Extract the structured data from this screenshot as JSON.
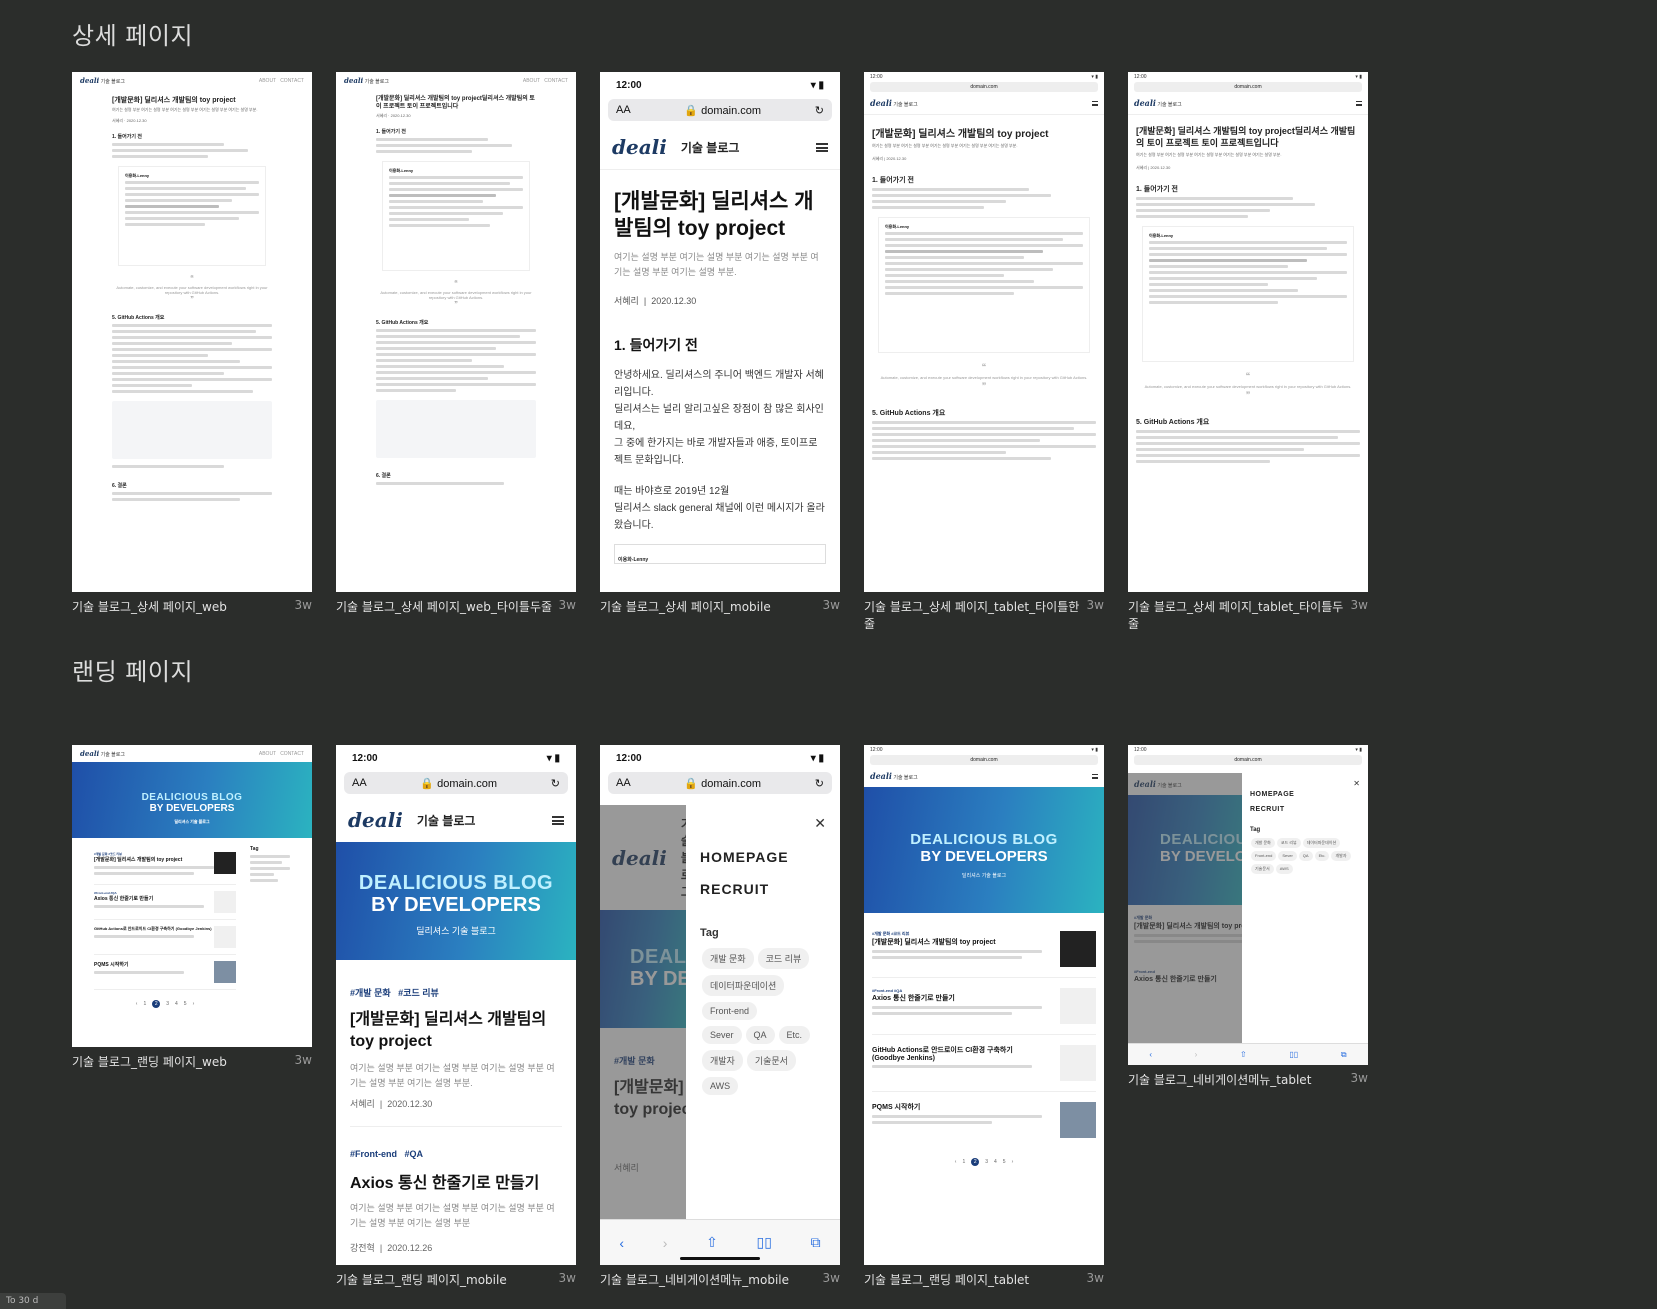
{
  "sections": {
    "detail": "상세 페이지",
    "landing": "랜딩 페이지"
  },
  "frames": [
    {
      "name": "기술 블로그_상세 페이지_web",
      "age": "3w"
    },
    {
      "name": "기술 블로그_상세 페이지_web_타이틀두줄",
      "age": "3w"
    },
    {
      "name": "기술 블로그_상세 페이지_mobile",
      "age": "3w"
    },
    {
      "name": "기술 블로그_상세 페이지_tablet_타이틀한줄",
      "age": "3w"
    },
    {
      "name": "기술 블로그_상세 페이지_tablet_타이틀두줄",
      "age": "3w"
    },
    {
      "name": "기술 블로그_랜딩 페이지_web",
      "age": "3w"
    },
    {
      "name": "기술 블로그_랜딩 페이지_mobile",
      "age": "3w"
    },
    {
      "name": "기술 블로그_네비게이션메뉴_mobile",
      "age": "3w"
    },
    {
      "name": "기술 블로그_랜딩 페이지_tablet",
      "age": "3w"
    },
    {
      "name": "기술 블로그_네비게이션메뉴_tablet",
      "age": "3w"
    }
  ],
  "content": {
    "blog_name": "기술 블로그",
    "logo_text": "deali",
    "status_time": "12:00",
    "url": "domain.com",
    "url_aa": "AA",
    "post_title_1line": "[개발문화] 딜리셔스 개발팀의 toy project",
    "post_title_2line": "[개발문화] 딜리셔스 개발팀의 toy project딜리셔스 개발팀의 토이 프로젝트 토이 프로젝트입니다",
    "mobile_title": "[개발문화] 딜리셔스 개발팀의 toy project",
    "post_desc": "여기는 설명 부분 여기는 설명 부분 여기는 설명 부분 여기는 설명 부분 여기는 설명 부분.",
    "author": "서혜리",
    "date": "2020.12.30",
    "section1": "1. 들어가기 전",
    "intro_1": "안녕하세요. 딜리셔스의 주니어 백엔드 개발자 서혜리입니다.",
    "intro_2": "딜리셔스는 널리 알리고싶은 장점이 참 많은 회사인데요,",
    "intro_3": "그 중에 한가지는 바로 개발자들과 애증, 토이프로젝트 문화입니다.",
    "intro_4": "때는 바야흐로 2019년 12월",
    "intro_5": "딜리셔스 slack general 채널에 이런 메시지가 올라왔습니다.",
    "slack_user": "이용화-Lenny",
    "section5": "5. GitHub Actions 개요",
    "section6": "6. 결론",
    "quote_text": "Automate, customize, and execute your software development workflows right in your repository with GitHub Actions.",
    "banner_line1": "DEALICIOUS BLOG",
    "banner_line2": "BY DEVELOPERS",
    "banner_sub": "딜리셔스 기술 블로그",
    "tags_post1": [
      "#개발 문화",
      "#코드 리뷰"
    ],
    "tags_post2": [
      "#Front-end",
      "#QA"
    ],
    "post2_title": "Axios 통신 한줄기로 만들기",
    "post2_desc": "여기는 설명 부분 여기는 설명 부분 여기는 설명 부분 여기는 설명 부분 여기는 설명 부분",
    "post2_author": "강전혁",
    "post2_date": "2020.12.26",
    "post3_title": "GitHub Actions로 안드로이드 CI환경 구축하기 (Goodbye Jenkins)",
    "post4_title": "PQMS 시작하기",
    "nav_home": "HOMEPAGE",
    "nav_recruit": "RECRUIT",
    "nav_tag_label": "Tag",
    "nav_chips": [
      "개발 문화",
      "코드 리뷰",
      "데이터파운데이션",
      "Front-end",
      "Sever",
      "QA",
      "Etc.",
      "개발자",
      "기술문서",
      "AWS"
    ],
    "pager": [
      "1",
      "2",
      "3",
      "4",
      "5"
    ],
    "close_glyph": "✕"
  },
  "bottom_tab": "To 30 d"
}
